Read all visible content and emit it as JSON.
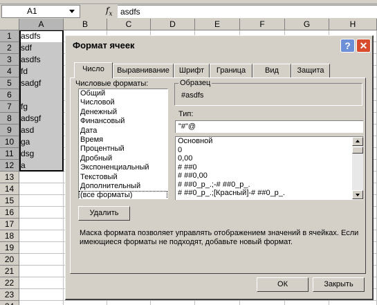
{
  "formula_bar": {
    "name_box": "A1",
    "fx_label": "f",
    "fx_sub": "x",
    "formula": "asdfs"
  },
  "sheet": {
    "columns": [
      "A",
      "B",
      "C",
      "D",
      "E",
      "F",
      "G",
      "H"
    ],
    "rows": [
      "1",
      "2",
      "3",
      "4",
      "5",
      "6",
      "7",
      "8",
      "9",
      "10",
      "11",
      "12",
      "13",
      "14",
      "15",
      "16",
      "17",
      "18",
      "19",
      "20",
      "21",
      "22",
      "23",
      "24"
    ],
    "cells_a": [
      "asdfs",
      "sdf",
      "asdfs",
      "fd",
      "sadgf",
      "",
      "fg",
      "adsgf",
      "asd",
      "ga",
      "dsg",
      "a"
    ]
  },
  "dialog": {
    "title": "Формат ячеек",
    "tabs": [
      "Число",
      "Выравнивание",
      "Шрифт",
      "Граница",
      "Вид",
      "Защита"
    ],
    "formats_label": "Числовые форматы:",
    "formats": [
      "Общий",
      "Числовой",
      "Денежный",
      "Финансовый",
      "Дата",
      "Время",
      "Процентный",
      "Дробный",
      "Экспоненциальный",
      "Текстовый",
      "Дополнительный",
      "(все форматы)"
    ],
    "sample_label": "Образец",
    "sample_value": "#asdfs",
    "type_label": "Тип:",
    "type_value": "\"#\"@",
    "type_list": [
      "Основной",
      "0",
      "0,00",
      "# ##0",
      "# ##0,00",
      "# ##0_р_.;-# ##0_р_.",
      "# ##0_р_.;[Красный]-# ##0_р_."
    ],
    "delete_label": "Удалить",
    "hint": "Маска формата позволяет управлять отображением значений в ячейках. Если имеющиеся форматы не подходят, добавьте новый формат.",
    "ok_label": "ОК",
    "close_label": "Закрыть",
    "help_glyph": "?",
    "close_glyph": "✕"
  }
}
